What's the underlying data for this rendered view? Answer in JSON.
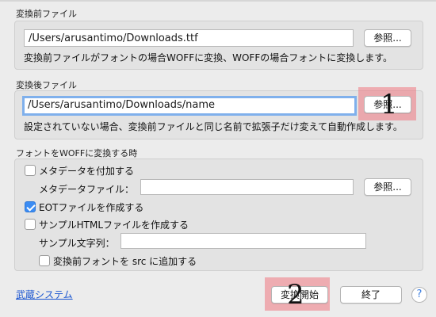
{
  "source_section": {
    "label": "変換前ファイル",
    "path_value": "/Users/arusantimo/Downloads.ttf",
    "browse_label": "参照...",
    "description": "変換前ファイルがフォントの場合WOFFに変換、WOFFの場合フォントに変換します。"
  },
  "dest_section": {
    "label": "変換後ファイル",
    "path_value": "/Users/arusantimo/Downloads/name",
    "browse_label": "参照...",
    "description": "設定されていない場合、変換前ファイルと同じ名前で拡張子だけ変えて自動作成します。"
  },
  "woff_section": {
    "label": "フォントをWOFFに変換する時",
    "metadata_checkbox_label": "メタデータを付加する",
    "metadata_checked": false,
    "metadata_file_label": "メタデータファイル：",
    "metadata_file_value": "",
    "metadata_browse_label": "参照...",
    "eot_checkbox_label": "EOTファイルを作成する",
    "eot_checked": true,
    "sample_html_checkbox_label": "サンプルHTMLファイルを作成する",
    "sample_html_checked": false,
    "sample_text_label": "サンプル文字列：",
    "sample_text_value": "",
    "add_src_checkbox_label": "変換前フォントを src に追加する",
    "add_src_checked": false
  },
  "footer": {
    "link_label": "武蔵システム",
    "convert_label": "変換開始",
    "quit_label": "終了",
    "help_glyph": "?"
  },
  "annotations": {
    "marker_1": "1",
    "marker_2": "2",
    "highlight_color": "#f07882"
  }
}
